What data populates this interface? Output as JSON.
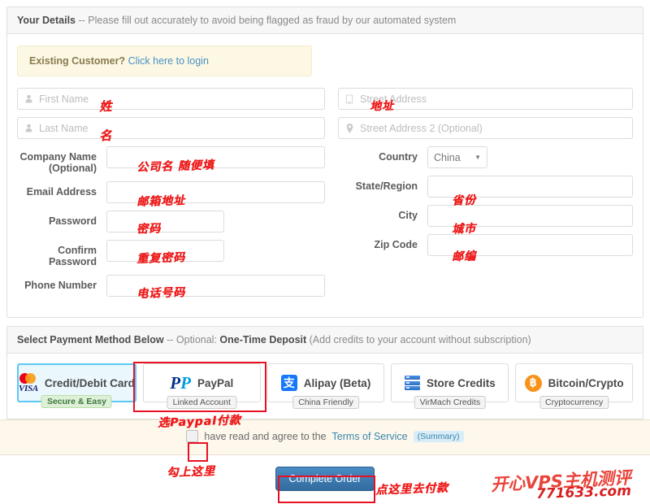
{
  "details_panel": {
    "header_strong": "Your Details",
    "header_rest": "-- Please fill out accurately to avoid being flagged as fraud by our automated system",
    "login_alert": {
      "bold": "Existing Customer?",
      "link": "Click here to login"
    },
    "left_fields": [
      {
        "label": "",
        "placeholder": "First Name",
        "icon": "user-icon",
        "type": "icon-input",
        "annotation": "姓"
      },
      {
        "label": "",
        "placeholder": "Last Name",
        "icon": "user-icon",
        "type": "icon-input",
        "annotation": "名"
      },
      {
        "label": "Company Name (Optional)",
        "label_line1": "Company Name",
        "label_line2": "(Optional)",
        "placeholder": "",
        "type": "labeled",
        "annotation": "公司名 随便填"
      },
      {
        "label": "Email Address",
        "placeholder": "",
        "type": "labeled",
        "annotation": "邮箱地址"
      },
      {
        "label": "Password",
        "placeholder": "",
        "type": "labeled-narrow",
        "annotation": "密码"
      },
      {
        "label": "Confirm Password",
        "placeholder": "",
        "type": "labeled-narrow",
        "annotation": "重复密码"
      },
      {
        "label": "Phone Number",
        "placeholder": "",
        "type": "labeled",
        "annotation": "电话号码"
      }
    ],
    "right_fields": [
      {
        "label": "",
        "placeholder": "Street Address",
        "icon": "building-icon",
        "type": "icon-input",
        "annotation": "地址"
      },
      {
        "label": "",
        "placeholder": "Street Address 2 (Optional)",
        "icon": "map-pin-icon",
        "type": "icon-input",
        "annotation": ""
      },
      {
        "label": "Country",
        "value": "China",
        "type": "select",
        "annotation": ""
      },
      {
        "label": "State/Region",
        "placeholder": "",
        "type": "labeled",
        "annotation": "省份"
      },
      {
        "label": "City",
        "placeholder": "",
        "type": "labeled",
        "annotation": "城市"
      },
      {
        "label": "Zip Code",
        "placeholder": "",
        "type": "labeled",
        "annotation": "邮编"
      }
    ]
  },
  "payment_panel": {
    "header_strong": "Select Payment Method Below",
    "header_mid": "-- Optional:",
    "header_bold2": "One-Time Deposit",
    "header_rest": "(Add credits to your account without subscription)",
    "methods": [
      {
        "name": "Credit/Debit Card",
        "tag": "Secure & Easy",
        "tag_style": "green",
        "icon": "mastercard-visa-icon",
        "selected": true
      },
      {
        "name": "PayPal",
        "tag": "Linked Account",
        "tag_style": "plain",
        "icon": "paypal-icon",
        "selected": false
      },
      {
        "name": "Alipay (Beta)",
        "tag": "China Friendly",
        "tag_style": "plain",
        "icon": "alipay-icon",
        "selected": false
      },
      {
        "name": "Store Credits",
        "tag": "VirMach Credits",
        "tag_style": "plain",
        "icon": "server-stack-icon",
        "selected": false
      },
      {
        "name": "Bitcoin/Crypto",
        "tag": "Cryptocurrency",
        "tag_style": "plain",
        "icon": "bitcoin-icon",
        "selected": false
      }
    ]
  },
  "terms": {
    "text": "have read and agree to the",
    "link": "Terms of Service",
    "summary": "(Summary)"
  },
  "order": {
    "button_label": "Complete Order"
  },
  "annotations": {
    "first_name": "姓",
    "last_name": "名",
    "company": "公司名 随便填",
    "email": "邮箱地址",
    "password": "密码",
    "confirm_password": "重复密码",
    "phone": "电话号码",
    "street": "地址",
    "state": "省份",
    "city": "城市",
    "zip": "邮编",
    "pay_paypal": "选Paypal付款",
    "check_here": "勾上这里",
    "click_to_pay": "点这里去付款"
  },
  "watermark": {
    "main": "开心VPS主机测评",
    "sub": "771633.com"
  },
  "colors": {
    "accent_blue": "#3a7cb5",
    "highlight_red": "#e81123",
    "annotation_red": "#ee1c1c",
    "selected_card": "#5bc8f5"
  }
}
